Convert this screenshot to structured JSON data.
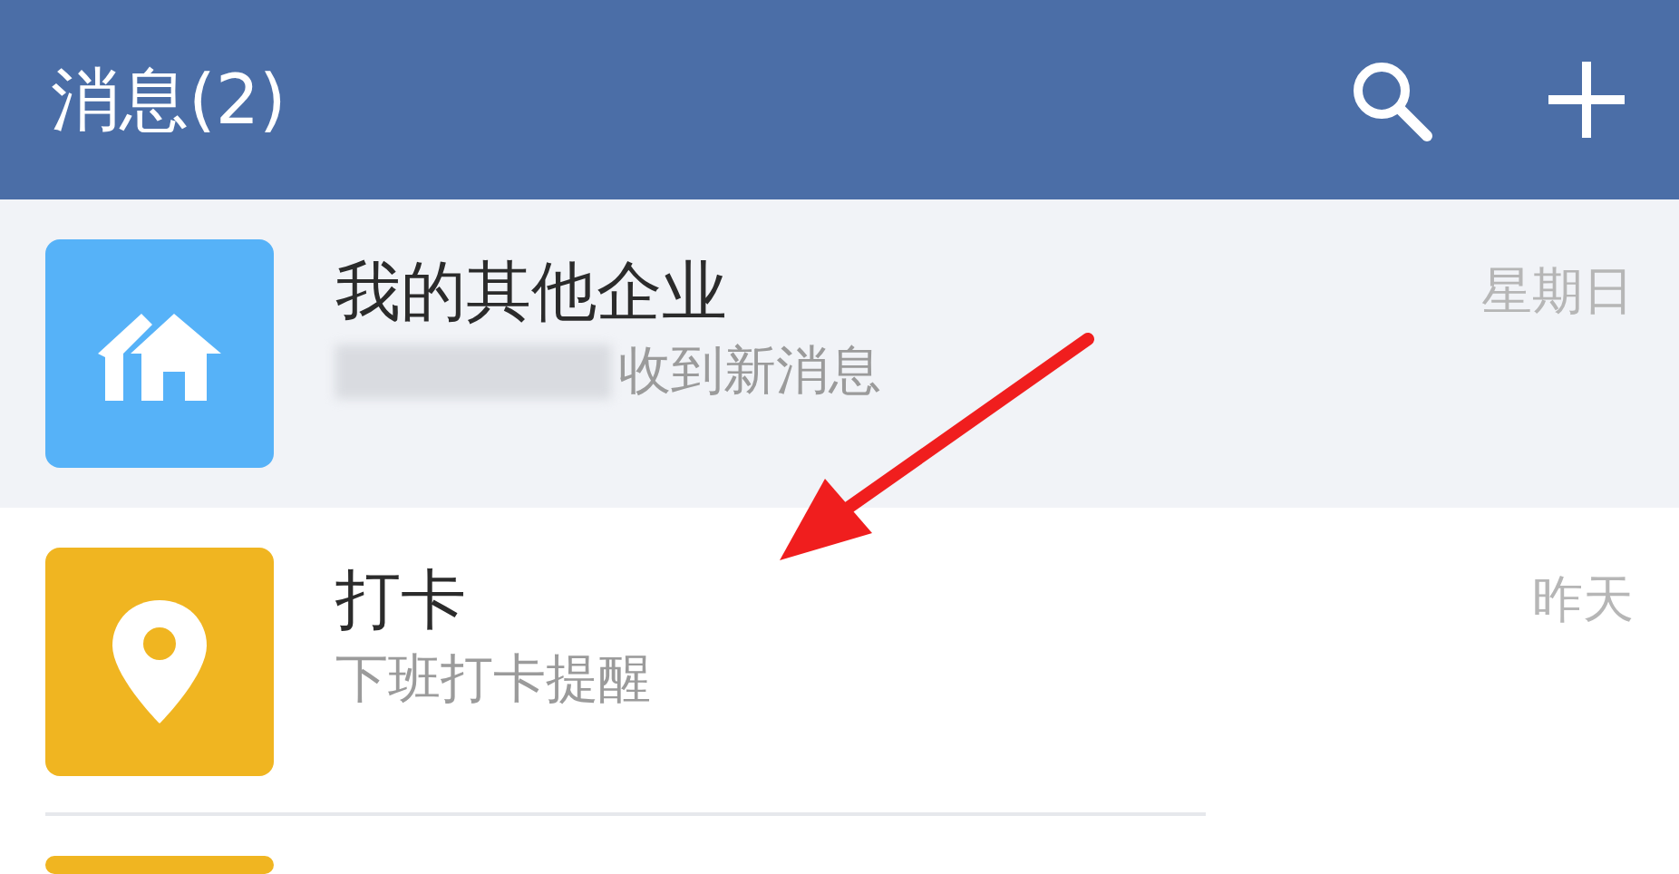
{
  "header": {
    "title": "消息(2)"
  },
  "conversations": [
    {
      "kind": "home",
      "color": "#56b2f8",
      "pinned": true,
      "sender_hidden": true,
      "title": "我的其他企业",
      "preview": "收到新消息",
      "time": "星期日"
    },
    {
      "kind": "pin",
      "color": "#f0b521",
      "pinned": false,
      "sender_hidden": false,
      "title": "打卡",
      "preview": "下班打卡提醒",
      "time": "昨天"
    },
    {
      "kind": "blank",
      "color": "#f0b521",
      "pinned": false,
      "sender_hidden": false
    }
  ]
}
